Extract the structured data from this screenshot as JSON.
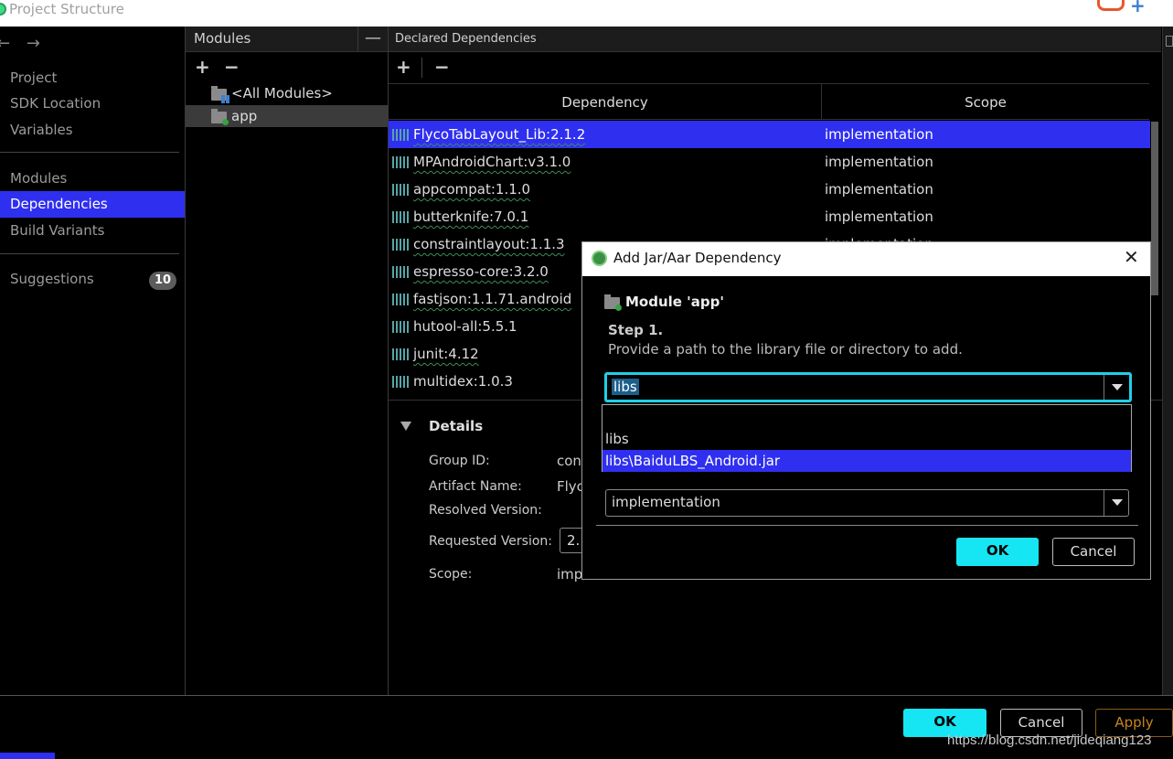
{
  "window": {
    "title": "Project Structure"
  },
  "nav": {
    "back": "←",
    "forward": "→",
    "items": [
      {
        "label": "Project"
      },
      {
        "label": "SDK Location"
      },
      {
        "label": "Variables"
      },
      {
        "label": "Modules"
      },
      {
        "label": "Dependencies"
      },
      {
        "label": "Build Variants"
      },
      {
        "label": "Suggestions",
        "badge": "10"
      }
    ]
  },
  "modules_panel": {
    "title": "Modules",
    "collapse": "—",
    "add": "+",
    "remove": "−",
    "items": [
      "<All Modules>",
      "app"
    ]
  },
  "deps_panel": {
    "title": "Declared Dependencies",
    "add": "+",
    "remove": "−",
    "columns": {
      "dependency": "Dependency",
      "scope": "Scope"
    },
    "rows": [
      {
        "name": "FlycoTabLayout_Lib:2.1.2",
        "scope": "implementation"
      },
      {
        "name": "MPAndroidChart:v3.1.0",
        "scope": "implementation"
      },
      {
        "name": "appcompat:1.1.0",
        "scope": "implementation"
      },
      {
        "name": "butterknife:7.0.1",
        "scope": "implementation"
      },
      {
        "name": "constraintlayout:1.1.3",
        "scope": "implementation"
      },
      {
        "name": "espresso-core:3.2.0",
        "scope": ""
      },
      {
        "name": "fastjson:1.1.71.android",
        "scope": ""
      },
      {
        "name": "hutool-all:5.5.1",
        "scope": ""
      },
      {
        "name": "junit:4.12",
        "scope": ""
      },
      {
        "name": "multidex:1.0.3",
        "scope": ""
      }
    ],
    "details": {
      "title": "Details",
      "fields": [
        {
          "label": "Group ID:",
          "value": "con"
        },
        {
          "label": "Artifact Name:",
          "value": "Flyc"
        },
        {
          "label": "Resolved Version:",
          "value": ""
        },
        {
          "label": "Requested Version:",
          "value": "2."
        },
        {
          "label": "Scope:",
          "value": "imp"
        }
      ]
    }
  },
  "dialog": {
    "title": "Add Jar/Aar Dependency",
    "close": "✕",
    "module": "Module 'app'",
    "step": "Step 1.",
    "step_desc": "Provide a path to the library file or directory to add.",
    "path_value": "libs",
    "dropdown_options": [
      "",
      "libs",
      "libs\\BaiduLBS_Android.jar"
    ],
    "scope_value": "implementation",
    "ok": "OK",
    "cancel": "Cancel"
  },
  "footer": {
    "ok": "OK",
    "cancel": "Cancel",
    "apply": "Apply"
  },
  "watermark": "https://blog.csdn.net/jideqiang123",
  "colors": {
    "selection": "#2f2ff0",
    "primary_button": "#16e5f3",
    "apply": "#c8831f"
  }
}
